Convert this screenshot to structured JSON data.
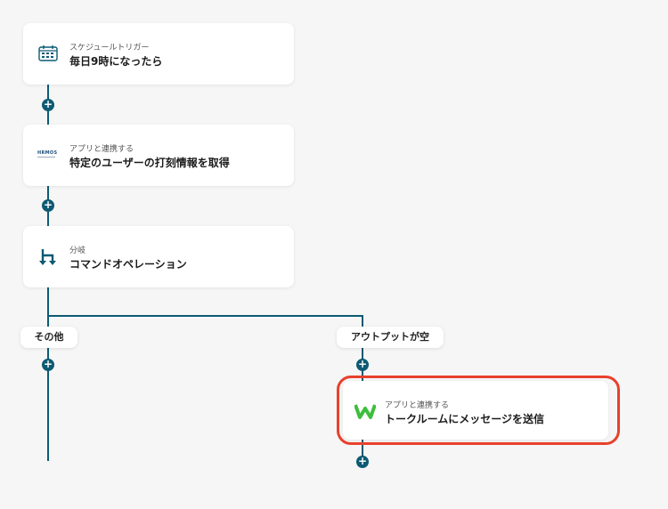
{
  "colors": {
    "connector": "#0d5a73",
    "highlight": "#e8412c",
    "yoom_green": "#3cbf3c"
  },
  "steps": [
    {
      "icon": "schedule-trigger-icon",
      "subtitle": "スケジュールトリガー",
      "title": "毎日9時になったら"
    },
    {
      "icon": "hrmos-logo-icon",
      "logo_text": "HRMOS",
      "subtitle": "アプリと連携する",
      "title": "特定のユーザーの打刻情報を取得"
    },
    {
      "icon": "branch-icon",
      "subtitle": "分岐",
      "title": "コマンドオペレーション"
    }
  ],
  "branches": {
    "left": {
      "label": "その他"
    },
    "right": {
      "label": "アウトプットが空"
    }
  },
  "branch_step": {
    "icon": "w-logo-icon",
    "subtitle": "アプリと連携する",
    "title": "トークルームにメッセージを送信"
  },
  "add_symbol": "+"
}
